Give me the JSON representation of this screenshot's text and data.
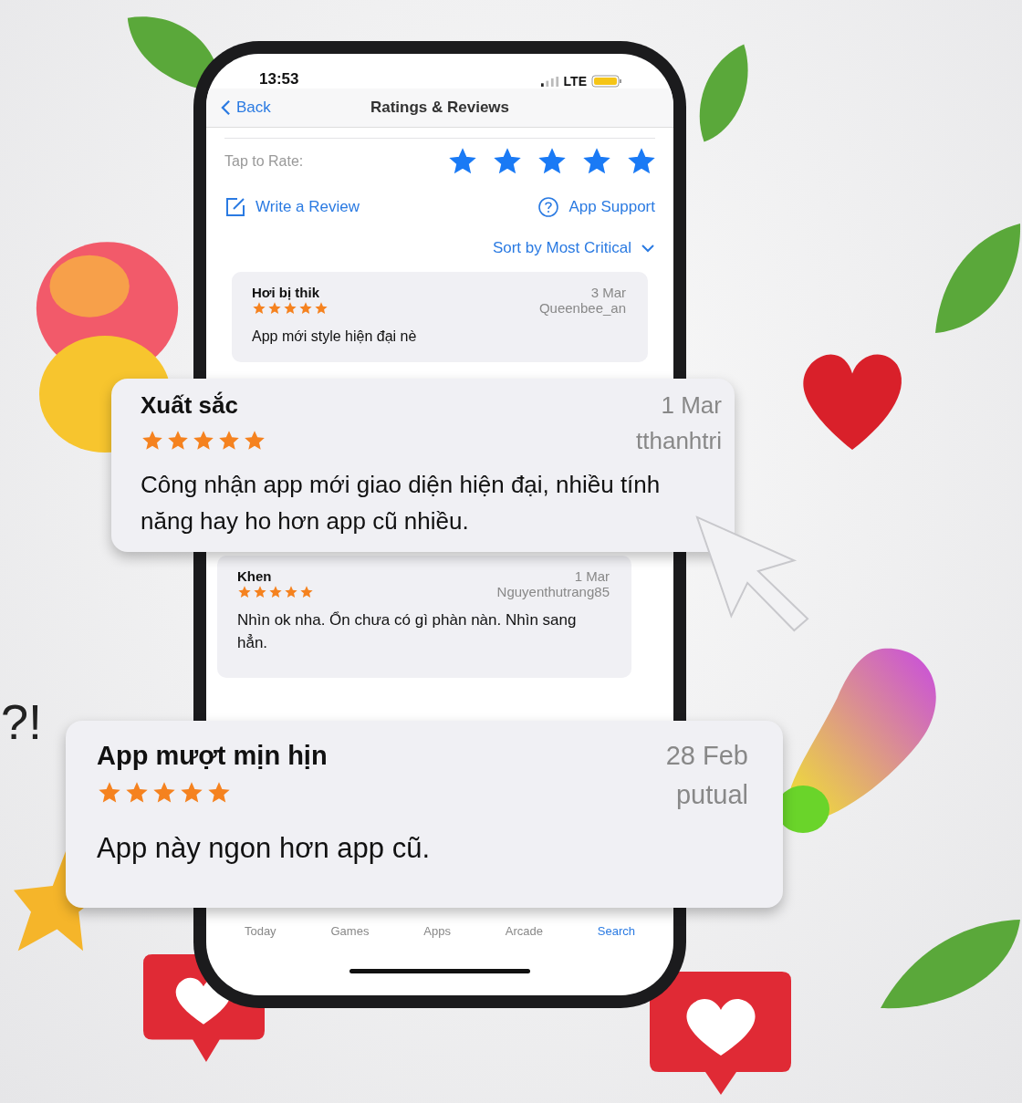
{
  "status_bar": {
    "time": "13:53",
    "network": "LTE"
  },
  "nav": {
    "back": "Back",
    "title": "Ratings & Reviews"
  },
  "rate": {
    "label": "Tap to Rate:",
    "stars": 5
  },
  "actions": {
    "write": "Write a Review",
    "support": "App Support"
  },
  "sort": "Sort by Most Critical",
  "screen_reviews": [
    {
      "title": "Hơi bị thik",
      "stars": 5,
      "date": "3 Mar",
      "author": "Queenbee_an",
      "body": "App mới style hiện đại nè"
    },
    {
      "title": "Khen",
      "stars": 5,
      "date": "1 Mar",
      "author": "Nguyenthutrang85",
      "body": "Nhìn ok nha. Ổn chưa có gì phàn nàn. Nhìn sang hẳn."
    }
  ],
  "featured_reviews": [
    {
      "title": "Xuất sắc",
      "stars": 5,
      "date": "1 Mar",
      "author": "tthanhtri",
      "body": "Công nhận app mới giao diện hiện đại, nhiều tính năng hay ho hơn app cũ nhiều."
    },
    {
      "title": "App mượt mịn hịn",
      "stars": 5,
      "date": "28 Feb",
      "author": "putual",
      "body": "App này ngon hơn app cũ."
    }
  ],
  "tab_bar": [
    {
      "label": "Today",
      "selected": false
    },
    {
      "label": "Games",
      "selected": false
    },
    {
      "label": "Apps",
      "selected": false
    },
    {
      "label": "Arcade",
      "selected": false
    },
    {
      "label": "Search",
      "selected": true
    }
  ],
  "side_text": "?!"
}
